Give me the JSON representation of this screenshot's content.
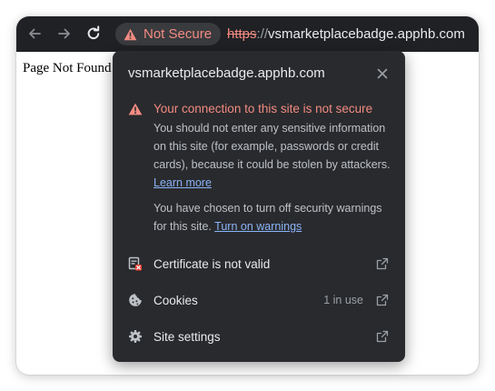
{
  "browser": {
    "security_chip_label": "Not Secure",
    "url_scheme": "https",
    "url_separator": "://",
    "url_host": "vsmarketplacebadge.apphb.com"
  },
  "page": {
    "body_text": "Page Not Found"
  },
  "site_info_popup": {
    "title": "vsmarketplacebadge.apphb.com",
    "warning_title": "Your connection to this site is not secure",
    "warning_text": "You should not enter any sensitive information on this site (for example, passwords or credit cards), because it could be stolen by attackers.",
    "learn_more_link": "Learn more",
    "warnings_off_text": "You have chosen to turn off security warnings for this site.",
    "turn_on_warnings_link": "Turn on warnings",
    "rows": [
      {
        "label": "Certificate is not valid",
        "icon": "certificate-error-icon",
        "meta": ""
      },
      {
        "label": "Cookies",
        "icon": "cookie-icon",
        "meta": "1 in use"
      },
      {
        "label": "Site settings",
        "icon": "gear-icon",
        "meta": ""
      }
    ]
  },
  "colors": {
    "toolbar_bg": "#202124",
    "popup_bg": "#292a2d",
    "danger": "#f28b82",
    "link": "#8ab4f8",
    "text_primary": "#e8eaed",
    "text_secondary": "#bdc1c6"
  }
}
